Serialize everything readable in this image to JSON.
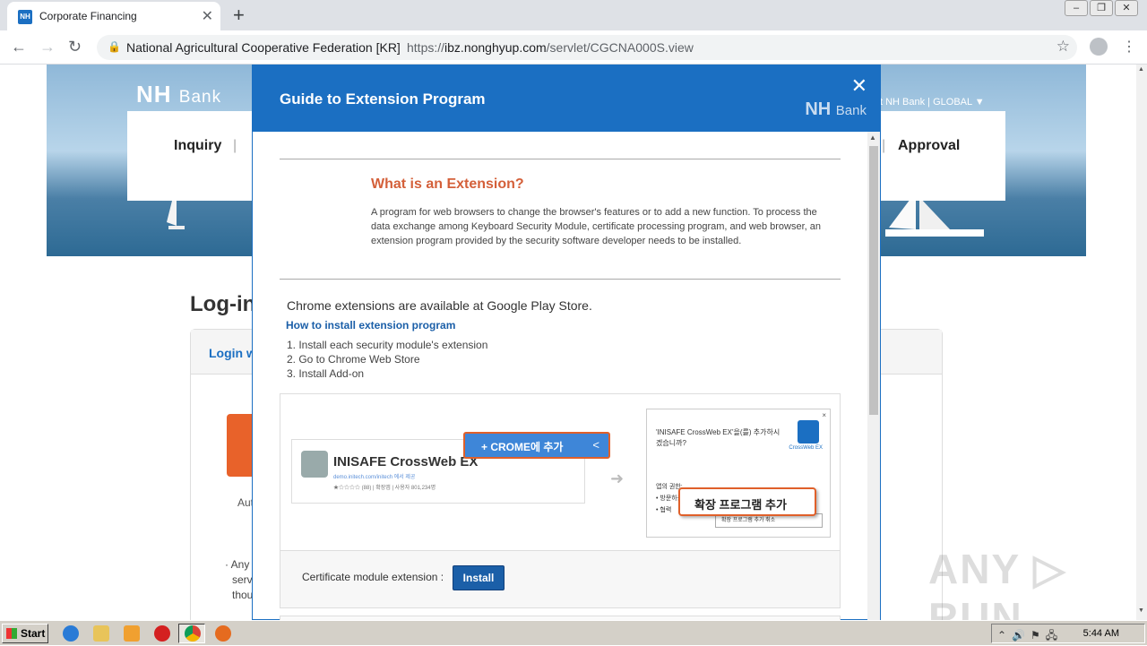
{
  "browser": {
    "tab_title": "Corporate Financing",
    "tab_favicon": "NH",
    "site_identity": "National Agricultural Cooperative Federation [KR]",
    "url_scheme": "https://",
    "url_host": "ibz.nonghyup.com",
    "url_path": "/servlet/CGCNA000S.view"
  },
  "page": {
    "logo_main": "NH",
    "logo_sub": "Bank",
    "top_links": "t NH Bank  |  GLOBAL  ▼",
    "gnb_left": "Inquiry",
    "gnb_left_sep": "|",
    "gnb_right_sep": "|",
    "gnb_right": "Approval",
    "login_title": "Log-in",
    "login_tab": "Login w",
    "auto_text": "Aut",
    "notice_line1": "· Any",
    "notice_line2": "serv",
    "notice_line3": "thou"
  },
  "modal": {
    "title": "Guide to Extension Program",
    "close": "✕",
    "logo_main": "NH",
    "logo_sub": "Bank",
    "what_title": "What is an Extension?",
    "what_desc": "A program for web browsers to change the browser's features or to add a new function. To process the data exchange among Keyboard Security Module, certificate processing program, and web browser, an extension program provided by the security software developer needs to be installed.",
    "chrome_text": "Chrome extensions are available at Google Play Store.",
    "how_title": "How to install extension program",
    "steps": [
      "1. Install each security module's extension",
      "2. Go to Chrome Web Store",
      "3. Install Add-on"
    ],
    "store_name": "INISAFE CrossWeb EX",
    "store_sub": "demo.initech.com/initech  에서 제공",
    "store_stars": "★☆☆☆☆ (88)     |    확장앱    |    사용자 801,234명",
    "crome_btn": "+ CROME에 추가",
    "share_icon": "<",
    "dialog_text": "'INISAFE CrossWeb EX'을(를) 추가하시겠습니까?",
    "dialog_x": "×",
    "dialog_lockname": "CrossWeb EX",
    "dialog_perm_title": "앱의 권한:",
    "dialog_perm1": "• 방문하는 웹사이트의 전체 데이터 조회 및 변경",
    "dialog_perm2": "• 협력",
    "dialog_buttons": "확장 프로그램 추가        취소",
    "ext_btn": "확장 프로그램 추가",
    "cert_text": "Certificate module extension :",
    "install_btn": "Install"
  },
  "watermark": "ANY ▷ RUN",
  "taskbar": {
    "start": "Start",
    "clock": "5:44 AM"
  },
  "colors": {
    "brand_blue": "#1b6fc2",
    "accent_orange": "#e0602a"
  }
}
